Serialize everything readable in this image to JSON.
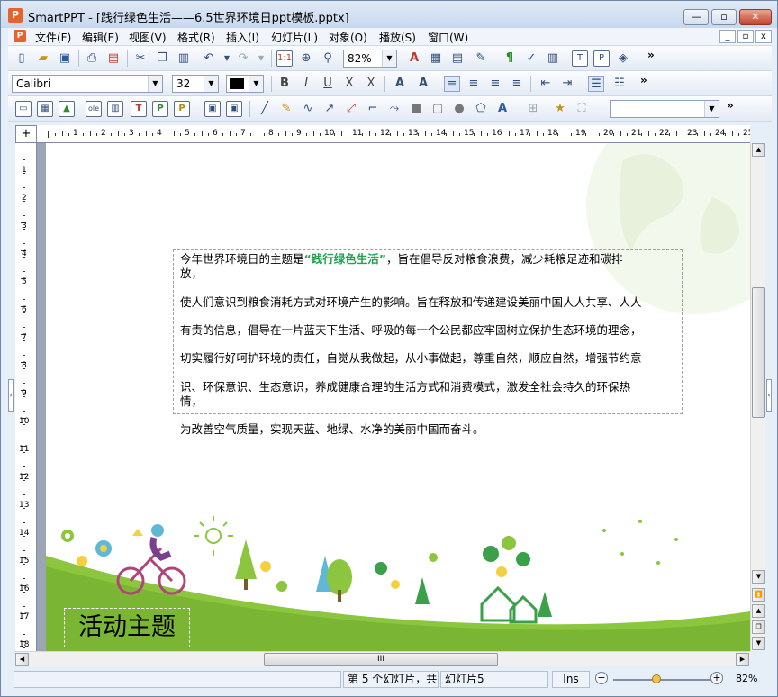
{
  "window": {
    "app_icon": "P",
    "title": "SmartPPT - [践行绿色生活——6.5世界环境日ppt模板.pptx]",
    "controls": [
      "—",
      "▫",
      "✕"
    ]
  },
  "menubar": {
    "items": [
      "文件(F)",
      "编辑(E)",
      "视图(V)",
      "格式(R)",
      "插入(I)",
      "幻灯片(L)",
      "对象(O)",
      "播放(S)",
      "窗口(W)"
    ],
    "mdi_controls": [
      "_",
      "▫",
      "x"
    ]
  },
  "toolbar1": {
    "zoom_value": "82%",
    "more": "»"
  },
  "toolbar2": {
    "font_name": "Calibri",
    "font_size": "32",
    "color_swatch": "#000000",
    "bold": "B",
    "italic": "I",
    "underline": "U",
    "more": "»"
  },
  "toolbar3": {
    "shape_combo_value": "",
    "more": "»"
  },
  "ruler": {
    "h_labels": [
      "1",
      "2",
      "3",
      "4",
      "5",
      "6",
      "7",
      "8",
      "9",
      "10",
      "11",
      "12",
      "13",
      "14",
      "15",
      "16",
      "17",
      "18",
      "19",
      "20",
      "21",
      "22",
      "23",
      "24",
      "25"
    ],
    "v_labels": [
      "1",
      "2",
      "3",
      "4",
      "5",
      "6",
      "7",
      "8",
      "9",
      "10",
      "11",
      "12",
      "13",
      "14",
      "15",
      "16",
      "17",
      "18"
    ],
    "corner": "+"
  },
  "slide": {
    "paragraph_lines": [
      {
        "pre": "今年世界环境日的主题是",
        "highlight": "“践行绿色生活”",
        "post": "，旨在倡导反对粮食浪费，减少耗粮足迹和碳排"
      },
      {
        "pre": "放，",
        "highlight": "",
        "post": ""
      },
      {
        "pre": "使人们意识到粮食消耗方式对环境产生的影响。旨在释放和传递建设美丽中国人人共享、人人",
        "highlight": "",
        "post": ""
      },
      {
        "pre": "有责的信息，倡导在一片蓝天下生活、呼吸的每一个公民都应牢固树立保护生态环境的理念，",
        "highlight": "",
        "post": ""
      },
      {
        "pre": "切实履行好呵护环境的责任，自觉从我做起，从小事做起，尊重自然，顺应自然，增强节约意",
        "highlight": "",
        "post": ""
      },
      {
        "pre": "识、环保意识、生态意识，养成健康合理的生活方式和消费模式，激发全社会持久的环保热",
        "highlight": "",
        "post": ""
      },
      {
        "pre": "情，",
        "highlight": "",
        "post": ""
      },
      {
        "pre": "为改善空气质量，实现天蓝、地绿、水净的美丽中国而奋斗。",
        "highlight": "",
        "post": ""
      }
    ],
    "title": "活动主题",
    "accent_green": "#20a14a",
    "grass_green": "#8cc63f"
  },
  "scroll": {
    "h_thumb_grip": "III"
  },
  "statusbar": {
    "slide_info": "第 5 个幻灯片，共",
    "slide_name": "幻灯片5",
    "mode": "Ins",
    "zoom_minus": "−",
    "zoom_plus": "+",
    "zoom_level": 0.41,
    "zoom_percent": "82%"
  }
}
